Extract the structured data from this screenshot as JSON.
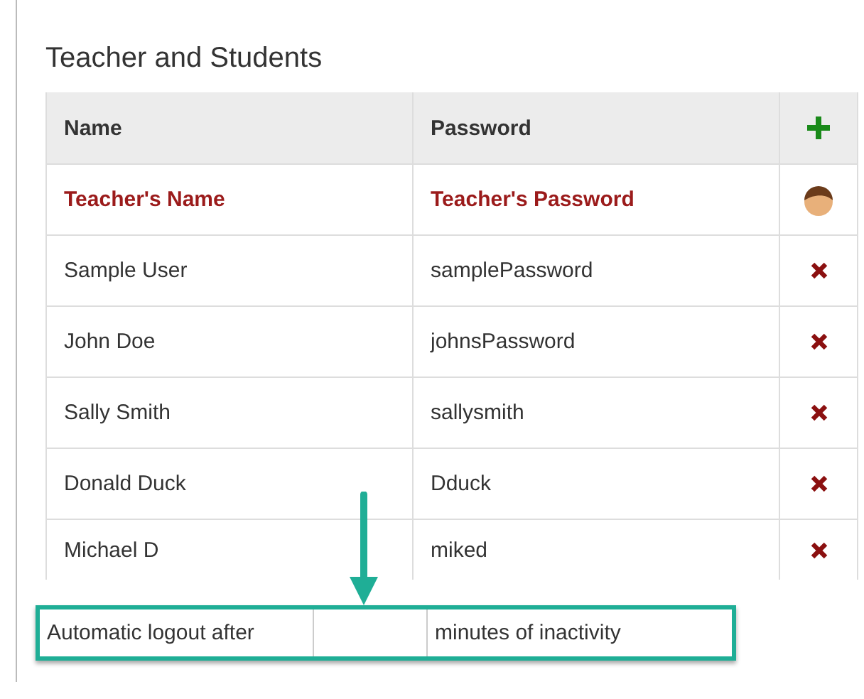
{
  "section_title": "Teacher and Students",
  "table": {
    "columns": [
      "Name",
      "Password"
    ],
    "rows": [
      {
        "kind": "teacher",
        "name": "Teacher's Name",
        "password": "Teacher's Password"
      },
      {
        "kind": "student",
        "name": "Sample User",
        "password": "samplePassword"
      },
      {
        "kind": "student",
        "name": "John Doe",
        "password": "johnsPassword"
      },
      {
        "kind": "student",
        "name": "Sally Smith",
        "password": "sallysmith"
      },
      {
        "kind": "student",
        "name": "Donald Duck",
        "password": "Dduck"
      },
      {
        "kind": "student",
        "name": "Michael D",
        "password": "miked"
      }
    ]
  },
  "logout": {
    "before": "Automatic logout after",
    "after": "minutes of inactivity"
  }
}
